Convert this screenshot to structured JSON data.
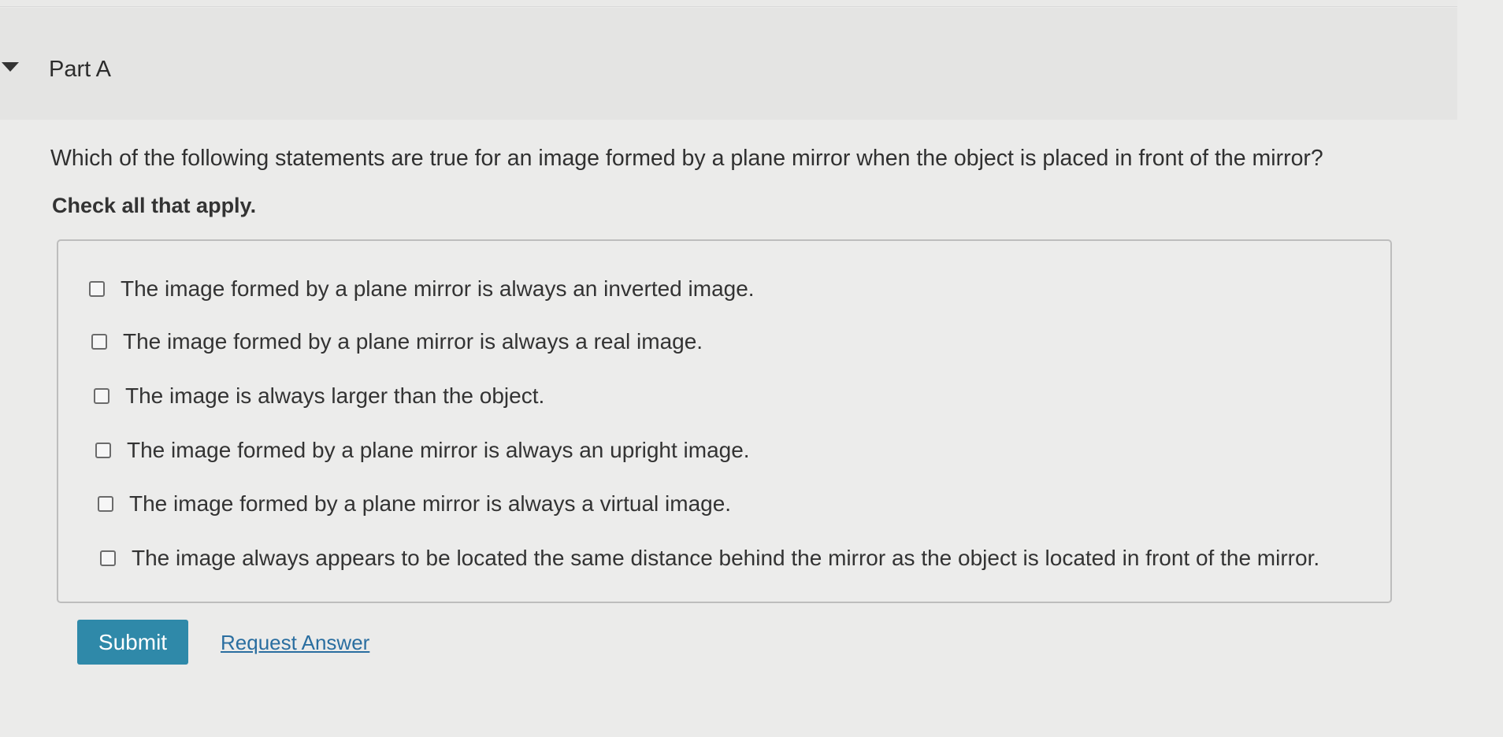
{
  "part": {
    "title": "Part A"
  },
  "question": {
    "text": "Which of the following statements are true for an image formed by a plane mirror when the object is placed in front of the mirror?",
    "instruction": "Check all that apply."
  },
  "options": [
    {
      "label": "The image formed by a plane mirror is always an inverted image.",
      "checked": false
    },
    {
      "label": "The image formed by a plane mirror is always a real image.",
      "checked": false
    },
    {
      "label": "The image is always larger than the object.",
      "checked": false
    },
    {
      "label": "The image formed by a plane mirror is always an upright image.",
      "checked": false
    },
    {
      "label": "The image formed by a plane mirror is always a virtual image.",
      "checked": false
    },
    {
      "label": "The image always appears to be located the same distance behind the mirror as the object is located in front of the mirror.",
      "checked": false
    }
  ],
  "actions": {
    "submit_label": "Submit",
    "request_answer_label": "Request Answer"
  },
  "colors": {
    "submit_bg": "#2f89a9",
    "link": "#2a6ea0"
  }
}
